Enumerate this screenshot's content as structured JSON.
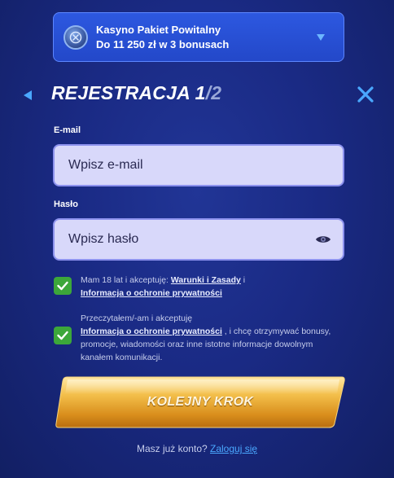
{
  "bonus": {
    "title": "Kasyno Pakiet Powitalny",
    "subtitle": "Do 11 250 zł w 3 bonusach",
    "icon": "casino-chip-icon"
  },
  "header": {
    "title": "REJESTRACJA ",
    "step": "1",
    "slash": "/",
    "total": "2"
  },
  "form": {
    "email_label": "E-mail",
    "email_placeholder": "Wpisz e-mail",
    "password_label": "Hasło",
    "password_placeholder": "Wpisz hasło"
  },
  "consents": [
    {
      "checked": true,
      "text_before": "Mam 18 lat i akceptuję: ",
      "link1": "Warunki i Zasady",
      "text_mid": " i",
      "link2": "Informacja o ochronie prywatności"
    },
    {
      "checked": true,
      "text_before": "Przeczytałem/-am i akceptuję",
      "link1": "Informacja o ochronie prywatności",
      "text_after": " , i chcę otrzymywać bonusy, promocje, wiadomości oraz inne istotne informacje dowolnym kanałem komunikacji."
    }
  ],
  "cta": {
    "label": "KOLEJNY KROK"
  },
  "footer": {
    "question": "Masz już konto? ",
    "login_link": "Zaloguj się"
  },
  "colors": {
    "background": "#1a2a84",
    "bonus_box": "#2a51d8",
    "input_fill": "#d8d8fa",
    "checkbox": "#3ca73a",
    "cta_gold": "#e3a62c",
    "link": "#4aa8ff"
  }
}
